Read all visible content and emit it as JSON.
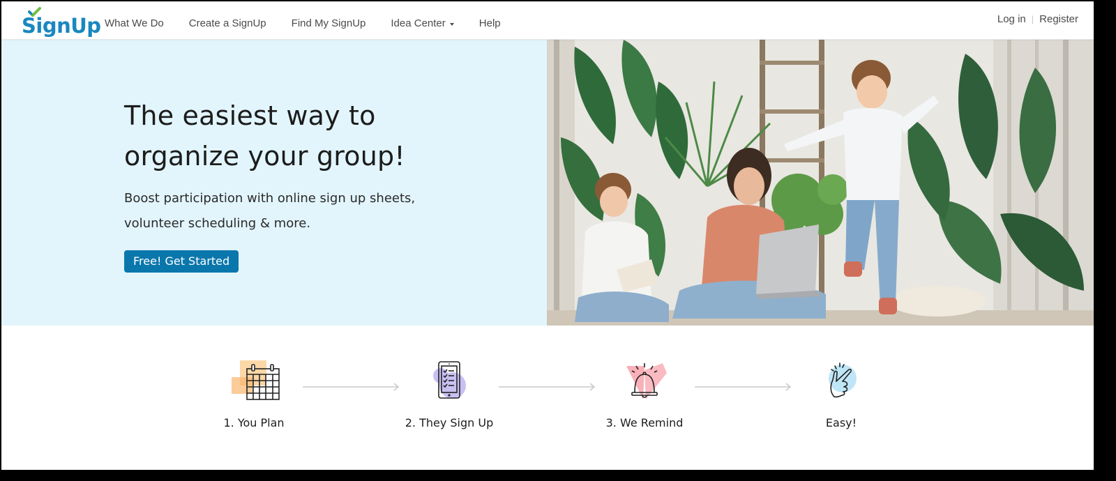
{
  "brand": {
    "name": "SignUp",
    "color": "#1a87c0",
    "check_color": "#6dbf44"
  },
  "nav": {
    "links": [
      {
        "label": "What We Do",
        "has_dropdown": false
      },
      {
        "label": "Create a SignUp",
        "has_dropdown": false
      },
      {
        "label": "Find My SignUp",
        "has_dropdown": false
      },
      {
        "label": "Idea Center",
        "has_dropdown": true
      },
      {
        "label": "Help",
        "has_dropdown": false
      }
    ],
    "login_label": "Log in",
    "separator": "|",
    "register_label": "Register"
  },
  "hero": {
    "title_line1": "The easiest way to",
    "title_line2": "organize your group!",
    "subtitle_line1": "Boost participation with online sign up sheets,",
    "subtitle_line2": "volunteer scheduling & more.",
    "cta_label": "Free! Get Started",
    "cta_color": "#0a77ac",
    "background_color": "#e2f5fc",
    "photo_description": "Mother with laptop, child reading, child jumping among houseplants"
  },
  "steps": [
    {
      "label": "1. You Plan",
      "icon": "calendar-icon",
      "accent": "#fbc98a"
    },
    {
      "label": "2. They Sign Up",
      "icon": "phone-checklist-icon",
      "accent": "#c9c0f2"
    },
    {
      "label": "3. We Remind",
      "icon": "bell-icon",
      "accent": "#f7a3ac"
    },
    {
      "label": "Easy!",
      "icon": "snap-hand-icon",
      "accent": "#bfe6f7"
    }
  ]
}
